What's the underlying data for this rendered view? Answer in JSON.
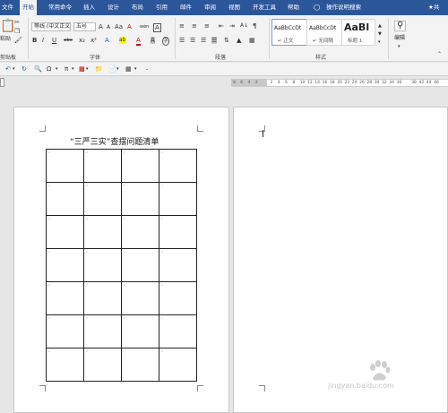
{
  "tabs": [
    "文件",
    "开始",
    "常用命令",
    "插入",
    "设计",
    "布局",
    "引用",
    "邮件",
    "审阅",
    "视图",
    "开发工具",
    "帮助",
    "操作说明搜索"
  ],
  "user_fragment": "共",
  "clipboard": {
    "paste": "粘贴",
    "group": "剪贴板"
  },
  "font": {
    "family": "等线 (中文正文)",
    "size": "五号",
    "group": "字体",
    "size_up": "A",
    "size_down": "A",
    "aa": "Aa",
    "wen": "wén",
    "a_box": "A",
    "bold": "B",
    "italic": "I",
    "underline": "U",
    "strike": "abc",
    "sub": "x₂",
    "sup": "x²",
    "clear": "A",
    "highlight": "ab",
    "color": "A",
    "char_shade": "A",
    "circle": "字"
  },
  "paragraph": {
    "group": "段落",
    "sort": "A↓",
    "marks": "¶"
  },
  "styles": {
    "group": "样式",
    "items": [
      {
        "sample": "AaBbCcDt",
        "name": "↵ 正文"
      },
      {
        "sample": "AaBbCcDt",
        "name": "↵ 无间隔"
      },
      {
        "sample": "AaBl",
        "name": "标题 1"
      }
    ]
  },
  "editing": {
    "label": "编辑",
    "group": ""
  },
  "ruler": {
    "ticks": [
      "8",
      "6",
      "4",
      "2",
      "",
      "2",
      "4",
      "6",
      "8",
      "10",
      "12",
      "14",
      "16",
      "18",
      "20",
      "22",
      "24",
      "26",
      "28",
      "30",
      "32",
      "34",
      "36",
      "",
      "38",
      "42",
      "44",
      "46"
    ]
  },
  "document": {
    "title": "“三严三实”查摆问题清单"
  },
  "watermark": {
    "text": "jingyan.baidu.com"
  }
}
